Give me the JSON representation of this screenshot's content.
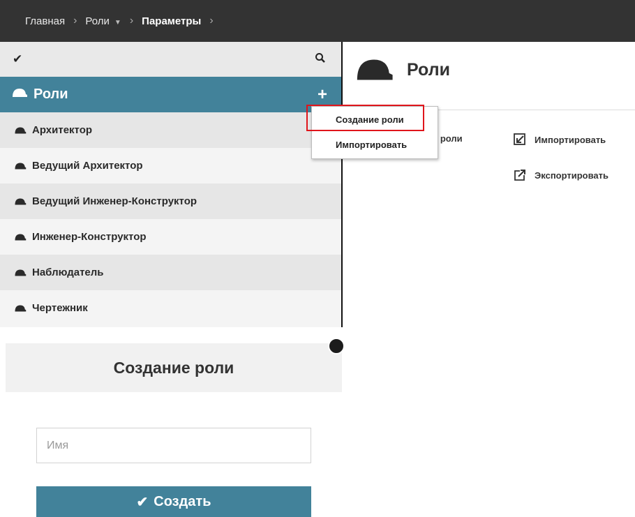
{
  "breadcrumb": {
    "items": [
      "Главная",
      "Роли",
      "Параметры"
    ],
    "separator": "›"
  },
  "left_panel": {
    "toolbar": {
      "check_icon": "check-icon",
      "search_icon": "search-icon"
    },
    "header": {
      "title": "Роли",
      "add_icon": "plus-icon"
    },
    "roles": [
      "Архитектор",
      "Ведущий Архитектор",
      "Ведущий Инженер-Конструктор",
      "Инженер-Конструктор",
      "Наблюдатель",
      "Чертежник"
    ]
  },
  "right_panel": {
    "title": "Роли",
    "partial_action": "е роли",
    "actions": {
      "import": "Импортировать",
      "export": "Экспортировать"
    }
  },
  "dropdown": {
    "items": [
      "Создание роли",
      "Импортировать"
    ],
    "highlighted": "Создание роли"
  },
  "create_form": {
    "title": "Создание роли",
    "name_placeholder": "Имя",
    "name_value": "",
    "submit_label": "Создать"
  },
  "colors": {
    "accent": "#42829a",
    "topbar": "#333333",
    "highlight": "#e0151b"
  }
}
